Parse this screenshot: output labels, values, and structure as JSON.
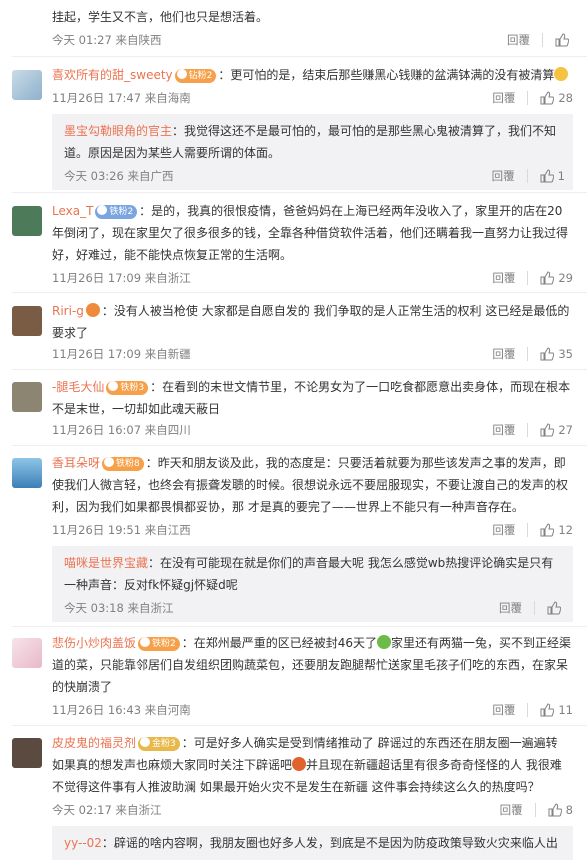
{
  "comments": [
    {
      "id": "c0",
      "text_line1": "挂起，学生又不言，他们也只是想活着。",
      "time": "今天 01:27 来自陕西",
      "reply": "回覆",
      "likes": ""
    },
    {
      "id": "c1",
      "user": "喜欢所有的甜_sweety",
      "badge": "钻粉2",
      "text": "：更可怕的是，结束后那些赚黑心钱赚的盆满钵满的没有被清算",
      "time": "11月26日 17:47 来自海南",
      "reply": "回覆",
      "likes": "28",
      "sub": {
        "user": "墨宝勾勒眼角的官主",
        "text": "：我觉得这还不是最可怕的，最可怕的是那些黑心鬼被清算了，我们不知道。原因是因为某些人需要所谓的体面。",
        "time": "今天 03:26 来自广西",
        "reply": "回覆",
        "likes": "1"
      }
    },
    {
      "id": "c2",
      "user": "Lexa_T",
      "badge": "铁粉2",
      "text": "：是的，我真的很恨疫情，爸爸妈妈在上海已经两年没收入了，家里开的店在20年倒闭了，现在家里欠了很多很多的钱，全靠各种借贷软件活着，他们还瞒着我一直努力让我过得好，好难过，能不能快点恢复正常的生活啊。",
      "time": "11月26日 17:09 来自浙江",
      "reply": "回覆",
      "likes": "29"
    },
    {
      "id": "c3",
      "user": "Riri-g",
      "text": "：没有人被当枪使 大家都是自愿自发的 我们争取的是人正常生活的权利 这已经是最低的要求了",
      "time": "11月26日 17:09 来自新疆",
      "reply": "回覆",
      "likes": "35"
    },
    {
      "id": "c4",
      "user": "-腿毛大仙",
      "badge": "铁粉3",
      "text": "：在看到的末世文情节里，不论男女为了一口吃食都愿意出卖身体，而现在根本不是末世，一切却如此魂天蔽日",
      "time": "11月26日 16:07 来自四川",
      "reply": "回覆",
      "likes": "27"
    },
    {
      "id": "c5",
      "user": "香耳朵呀",
      "badge": "铁粉8",
      "text": "：昨天和朋友谈及此，我的态度是：只要活着就要为那些该发声之事的发声，即使我们人微言轻，也终会有振聋发聩的时候。很想说永远不要屈服现实，不要让渡自己的发声的权利，因为我们如果都畏惧都妥协，那 才是真的要完了——世界上不能只有一种声音存在。",
      "time": "11月26日 19:51 来自江西",
      "reply": "回覆",
      "likes": "12",
      "sub": {
        "user": "喵咪是世界宝藏",
        "text": "：在没有可能现在就是你们的声音最大呢 我怎么感觉wb热搜评论确实是只有一种声音：反对fk怀疑gj怀疑d呢",
        "time": "今天 03:18 来自浙江",
        "reply": "回覆",
        "likes": ""
      }
    },
    {
      "id": "c6",
      "user": "悲伤小炒肉盖饭",
      "badge": "铁粉2",
      "text_a": "：在郑州最严重的区已经被封46天了",
      "text_b": "家里还有两猫一兔，买不到正经渠道的菜，只能靠邻居们自发组织团购蔬菜包，还要朋友跑腿帮忙送家里毛孩子们吃的东西，在家呆的快崩溃了",
      "time": "11月26日 16:43 来自河南",
      "reply": "回覆",
      "likes": "11"
    },
    {
      "id": "c7",
      "user": "皮皮鬼的福灵剂",
      "badge": "金粉3",
      "text_a": "：可是好多人确实是受到情绪推动了 辟谣过的东西还在朋友圈一遍遍转 如果真的想发声也麻烦大家同时关注下辟谣吧",
      "text_b": "并且现在新疆超话里有很多奇奇怪怪的人 我很难不觉得这件事有人推波助澜 如果最开始火灾不是发生在新疆 这件事会持续这么久的热度吗？",
      "time": "今天 02:17 来自浙江",
      "reply": "回覆",
      "likes": "8",
      "sub": {
        "user": "yy--02",
        "text": "：辟谣的啥内容啊，我朋友圈也好多人发，到底是不是因为防疫政策导致火灾来临人出",
        "time": "",
        "reply": "",
        "likes": ""
      }
    }
  ]
}
